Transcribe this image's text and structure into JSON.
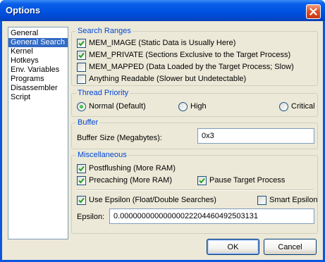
{
  "window": {
    "title": "Options"
  },
  "nav": {
    "items": [
      {
        "label": "General",
        "selected": false
      },
      {
        "label": "General Search",
        "selected": true
      },
      {
        "label": "Kernel",
        "selected": false
      },
      {
        "label": "Hotkeys",
        "selected": false
      },
      {
        "label": "Env. Variables",
        "selected": false
      },
      {
        "label": "Programs",
        "selected": false
      },
      {
        "label": "Disassembler",
        "selected": false
      },
      {
        "label": "Script",
        "selected": false
      }
    ]
  },
  "search_ranges": {
    "title": "Search Ranges",
    "options": [
      {
        "label": "MEM_IMAGE (Static Data is Usually Here)",
        "checked": true
      },
      {
        "label": "MEM_PRIVATE (Sections Exclusive to the Target Process)",
        "checked": true
      },
      {
        "label": "MEM_MAPPED (Data Loaded by the Target Process; Slow)",
        "checked": false
      },
      {
        "label": "Anything Readable (Slower but Undetectable)",
        "checked": false
      }
    ]
  },
  "thread_priority": {
    "title": "Thread Priority",
    "options": [
      {
        "label": "Normal (Default)",
        "selected": true
      },
      {
        "label": "High",
        "selected": false
      },
      {
        "label": "Critical",
        "selected": false
      }
    ]
  },
  "buffer": {
    "title": "Buffer",
    "size_label": "Buffer Size (Megabytes):",
    "size_value": "0x3"
  },
  "misc": {
    "title": "Miscellaneous",
    "postflushing": {
      "label": "Postflushing (More RAM)",
      "checked": true
    },
    "precaching": {
      "label": "Precaching (More RAM)",
      "checked": true
    },
    "pause_target": {
      "label": "Pause Target Process",
      "checked": true
    },
    "use_epsilon": {
      "label": "Use Epsilon (Float/Double Searches)",
      "checked": true
    },
    "smart_epsilon": {
      "label": "Smart Epsilon",
      "checked": false
    },
    "epsilon_label": "Epsilon:",
    "epsilon_value": "0.00000000000000022204460492503131"
  },
  "buttons": {
    "ok": "OK",
    "cancel": "Cancel"
  },
  "colors": {
    "titlebar": "#0054e3",
    "group_title": "#0046d5",
    "face": "#ece9d8",
    "selection": "#316ac5"
  }
}
